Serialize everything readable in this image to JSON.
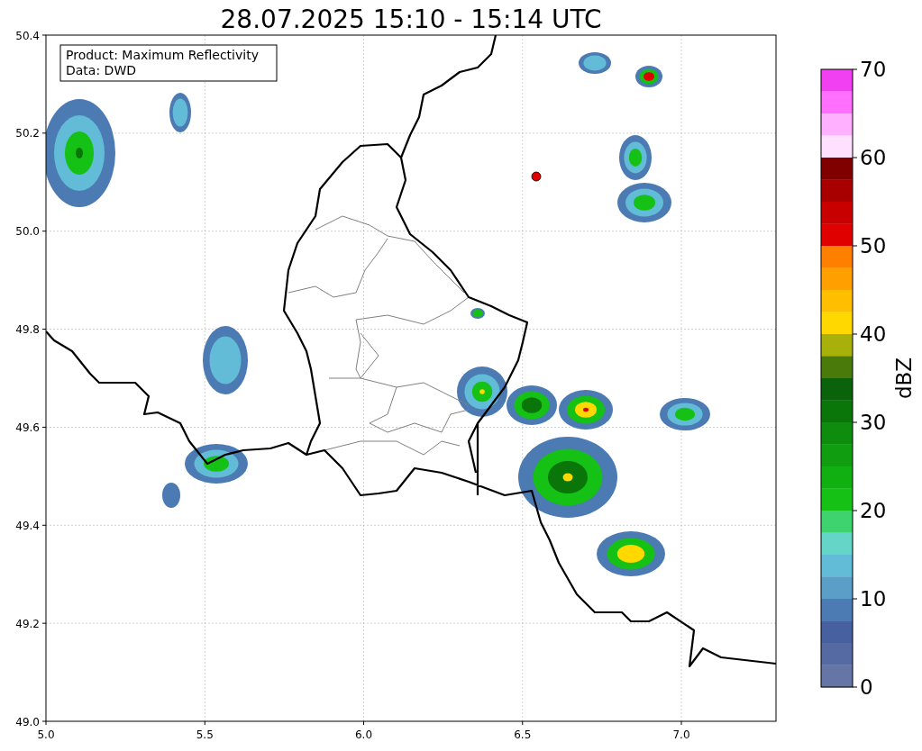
{
  "title": "28.07.2025 15:10 - 15:14 UTC",
  "map": {
    "info_lines": [
      "Product: Maximum Reflectivity",
      "Data: DWD"
    ],
    "x_ticks": [
      "5.0",
      "5.5",
      "6.0",
      "6.5",
      "7.0"
    ],
    "y_ticks": [
      "50.4",
      "50.2",
      "50.0",
      "49.8",
      "49.6",
      "49.4",
      "49.2",
      "49.0"
    ]
  },
  "colorbar": {
    "label": "dBZ",
    "ticks": [
      "70",
      "60",
      "50",
      "40",
      "30",
      "20",
      "10",
      "0"
    ],
    "segments": [
      {
        "color": "#f040f0"
      },
      {
        "color": "#ff70ff"
      },
      {
        "color": "#ffb0ff"
      },
      {
        "color": "#ffe0ff"
      },
      {
        "color": "#800000"
      },
      {
        "color": "#a80000"
      },
      {
        "color": "#c80000"
      },
      {
        "color": "#e00000"
      },
      {
        "color": "#ff8000"
      },
      {
        "color": "#ffa000"
      },
      {
        "color": "#ffbf00"
      },
      {
        "color": "#ffd800"
      },
      {
        "color": "#a8b00a"
      },
      {
        "color": "#4a7a0a"
      },
      {
        "color": "#0a620a"
      },
      {
        "color": "#0a760a"
      },
      {
        "color": "#0d8c0d"
      },
      {
        "color": "#109e10"
      },
      {
        "color": "#10b010"
      },
      {
        "color": "#14c114"
      },
      {
        "color": "#3ed36f"
      },
      {
        "color": "#64d5c6"
      },
      {
        "color": "#62bcd8"
      },
      {
        "color": "#5b9ec8"
      },
      {
        "color": "#4b7bb2"
      },
      {
        "color": "#4760a0"
      },
      {
        "color": "#5569a3"
      },
      {
        "color": "#6475a6"
      }
    ]
  }
}
